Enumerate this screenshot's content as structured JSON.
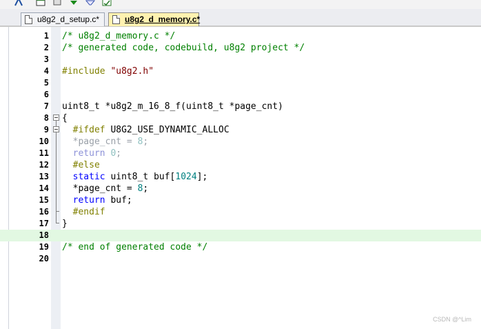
{
  "tabs": [
    {
      "label": "u8g2_d_setup.c*",
      "active": false
    },
    {
      "label": "u8g2_d_memory.c*",
      "active": true
    }
  ],
  "lines": [
    {
      "n": "1",
      "tokens": [
        {
          "t": "/* u8g2_d_memory.c */",
          "c": "comment"
        }
      ]
    },
    {
      "n": "2",
      "tokens": [
        {
          "t": "/* generated code, codebuild, u8g2 project */",
          "c": "comment"
        }
      ]
    },
    {
      "n": "3",
      "tokens": []
    },
    {
      "n": "4",
      "tokens": [
        {
          "t": "#include ",
          "c": "pp"
        },
        {
          "t": "\"u8g2.h\"",
          "c": "str"
        }
      ]
    },
    {
      "n": "5",
      "tokens": []
    },
    {
      "n": "6",
      "tokens": []
    },
    {
      "n": "7",
      "tokens": [
        {
          "t": "uint8_t *u8g2_m_16_8_f(uint8_t *page_cnt)",
          "c": ""
        }
      ]
    },
    {
      "n": "8",
      "tokens": [
        {
          "t": "{",
          "c": ""
        }
      ]
    },
    {
      "n": "9",
      "tokens": [
        {
          "t": "  ",
          "c": ""
        },
        {
          "t": "#ifdef ",
          "c": "pp"
        },
        {
          "t": "U8G2_USE_DYNAMIC_ALLOC",
          "c": ""
        }
      ]
    },
    {
      "n": "10",
      "tokens": [
        {
          "t": "  *page_cnt = ",
          "c": "dim"
        },
        {
          "t": "8",
          "c": "num-dim"
        },
        {
          "t": ";",
          "c": "dim"
        }
      ]
    },
    {
      "n": "11",
      "tokens": [
        {
          "t": "  ",
          "c": ""
        },
        {
          "t": "return ",
          "c": "kw-dim"
        },
        {
          "t": "0",
          "c": "num-dim"
        },
        {
          "t": ";",
          "c": "dim"
        }
      ]
    },
    {
      "n": "12",
      "tokens": [
        {
          "t": "  ",
          "c": ""
        },
        {
          "t": "#else",
          "c": "pp"
        }
      ]
    },
    {
      "n": "13",
      "tokens": [
        {
          "t": "  ",
          "c": ""
        },
        {
          "t": "static ",
          "c": "kw"
        },
        {
          "t": "uint8_t buf[",
          "c": ""
        },
        {
          "t": "1024",
          "c": "num"
        },
        {
          "t": "];",
          "c": ""
        }
      ]
    },
    {
      "n": "14",
      "tokens": [
        {
          "t": "  *page_cnt = ",
          "c": ""
        },
        {
          "t": "8",
          "c": "num"
        },
        {
          "t": ";",
          "c": ""
        }
      ]
    },
    {
      "n": "15",
      "tokens": [
        {
          "t": "  ",
          "c": ""
        },
        {
          "t": "return ",
          "c": "kw"
        },
        {
          "t": "buf;",
          "c": ""
        }
      ]
    },
    {
      "n": "16",
      "tokens": [
        {
          "t": "  ",
          "c": ""
        },
        {
          "t": "#endif",
          "c": "pp"
        }
      ]
    },
    {
      "n": "17",
      "tokens": [
        {
          "t": "}",
          "c": ""
        }
      ]
    },
    {
      "n": "18",
      "tokens": [],
      "current": true
    },
    {
      "n": "19",
      "tokens": [
        {
          "t": "/* end of generated code */",
          "c": "comment"
        }
      ]
    },
    {
      "n": "20",
      "tokens": []
    }
  ],
  "watermark": "CSDN @^Lim",
  "icons": [
    "structure-icon",
    "window-icon",
    "stack-icon",
    "diamond-down-icon",
    "filter-icon",
    "image-check-icon",
    "file-icon"
  ],
  "colors": {
    "comment": "#008000",
    "keyword": "#0000ff",
    "number": "#008080",
    "string": "#800000",
    "preprocessor": "#808000",
    "current_line": "#e2f8e2",
    "active_tab": "#fff2b0"
  }
}
